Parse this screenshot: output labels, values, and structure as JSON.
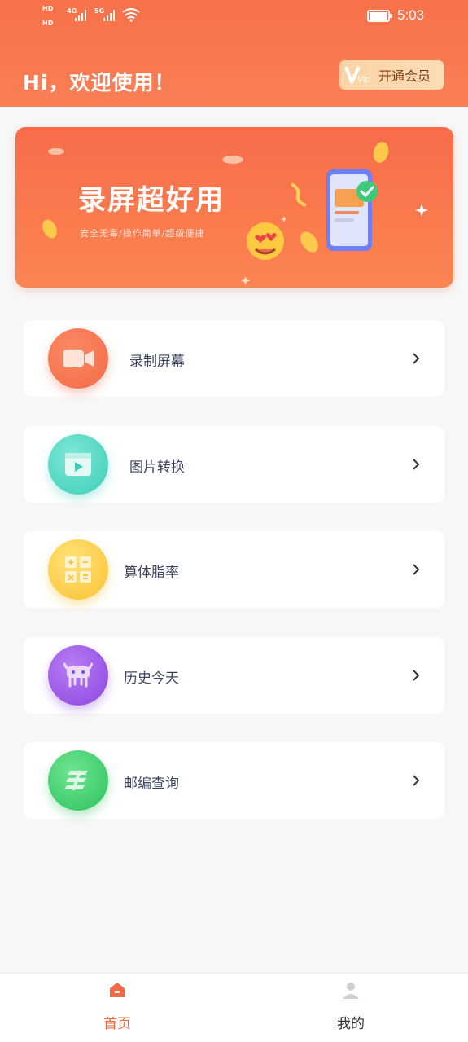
{
  "status_bar": {
    "sim1": "HD",
    "sim2": "HD",
    "net1": "4G",
    "net2": "5G",
    "time": "5:03"
  },
  "header": {
    "greeting": "Hi，欢迎使用！",
    "vip_button": "开通会员",
    "vip_badge": "Vip"
  },
  "banner": {
    "title": "录屏超好用",
    "subtitle": "安全无毒/操作简单/超级便捷"
  },
  "menu": [
    {
      "label": "录制屏幕",
      "icon": "video-camera-icon",
      "color": "#f66f4b"
    },
    {
      "label": "图片转换",
      "icon": "film-play-icon",
      "color": "#4fd9c2"
    },
    {
      "label": "算体脂率",
      "icon": "calculator-icon",
      "color": "#fcc93e"
    },
    {
      "label": "历史今天",
      "icon": "history-monster-icon",
      "color": "#9b57e6"
    },
    {
      "label": "邮编查询",
      "icon": "postal-code-icon",
      "color": "#3dcf6a"
    }
  ],
  "bottom_nav": [
    {
      "label": "首页",
      "icon": "home-icon",
      "active": true,
      "color": "#f26a45"
    },
    {
      "label": "我的",
      "icon": "user-icon",
      "active": false,
      "color": "#333333"
    }
  ]
}
